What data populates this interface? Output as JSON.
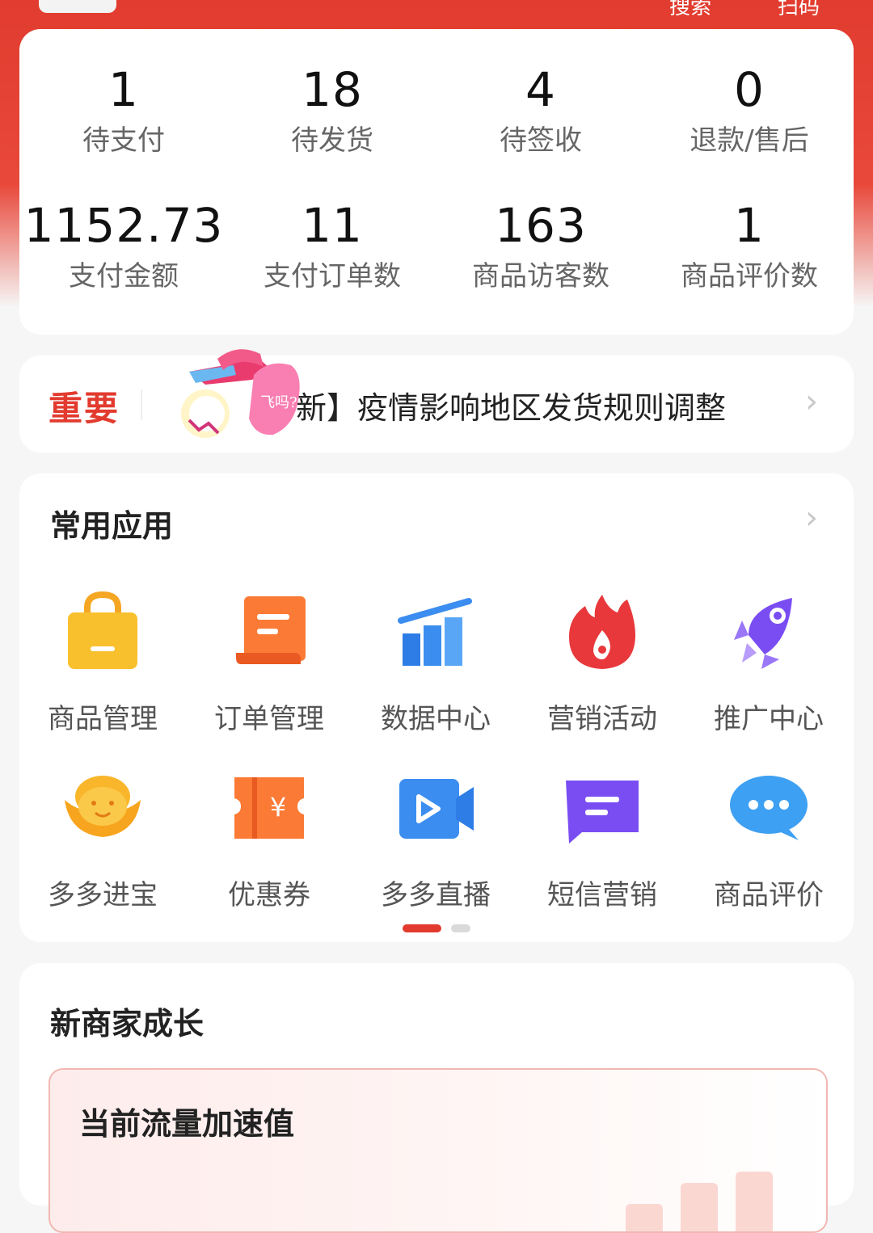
{
  "header": {
    "search_label": "搜索",
    "scan_label": "扫码"
  },
  "stats": [
    {
      "value": "1",
      "label": "待支付"
    },
    {
      "value": "18",
      "label": "待发货"
    },
    {
      "value": "4",
      "label": "待签收"
    },
    {
      "value": "0",
      "label": "退款/售后"
    },
    {
      "value": "1152.73",
      "label": "支付金额"
    },
    {
      "value": "11",
      "label": "支付订单数"
    },
    {
      "value": "163",
      "label": "商品访客数"
    },
    {
      "value": "1",
      "label": "商品评价数"
    }
  ],
  "notice": {
    "tag": "重要",
    "text": "新】疫情影响地区发货规则调整",
    "sticker_text": "飞吗?"
  },
  "apps_section": {
    "title": "常用应用",
    "items": [
      {
        "label": "商品管理",
        "icon": "shopping-bag-icon"
      },
      {
        "label": "订单管理",
        "icon": "order-scroll-icon"
      },
      {
        "label": "数据中心",
        "icon": "bar-chart-icon"
      },
      {
        "label": "营销活动",
        "icon": "flame-icon"
      },
      {
        "label": "推广中心",
        "icon": "rocket-icon"
      },
      {
        "label": "多多进宝",
        "icon": "gold-ingot-icon"
      },
      {
        "label": "优惠券",
        "icon": "coupon-icon"
      },
      {
        "label": "多多直播",
        "icon": "video-camera-icon"
      },
      {
        "label": "短信营销",
        "icon": "message-icon"
      },
      {
        "label": "商品评价",
        "icon": "chat-bubble-icon"
      }
    ],
    "page_count": 2,
    "active_page": 1
  },
  "growth_section": {
    "title": "新商家成长",
    "boost_title": "当前流量加速值"
  },
  "colors": {
    "accent": "#e23a2e",
    "header_bg": "#e13c2f",
    "page_bg": "#f6f6f6"
  }
}
